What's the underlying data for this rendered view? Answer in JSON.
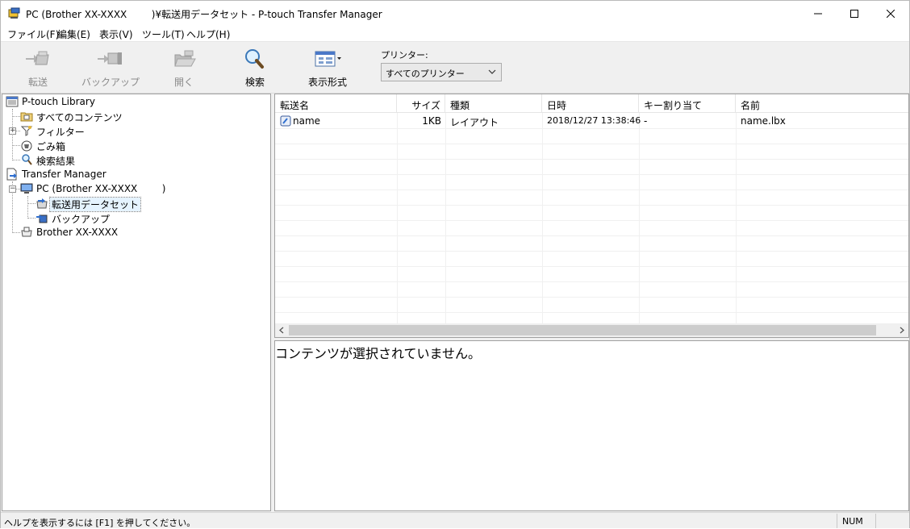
{
  "window": {
    "title": "PC (Brother XX-XXXX        )¥転送用データセット - P-touch Transfer Manager"
  },
  "menu": [
    {
      "label": "ファイル(F)"
    },
    {
      "label": "編集(E)"
    },
    {
      "label": "表示(V)"
    },
    {
      "label": "ツール(T)"
    },
    {
      "label": "ヘルプ(H)"
    }
  ],
  "toolbar": {
    "transfer_label": "転送",
    "backup_label": "バックアップ",
    "open_label": "開く",
    "search_label": "検索",
    "view_label": "表示形式",
    "printer_label": "プリンター:",
    "printer_value": "すべてのプリンター"
  },
  "tree": {
    "library": "P-touch Library",
    "all_contents": "すべてのコンテンツ",
    "filter": "フィルター",
    "trash": "ごみ箱",
    "search_results": "検索結果",
    "transfer_manager": "Transfer Manager",
    "pc": "PC (Brother XX-XXXX        )",
    "transfer_dataset": "転送用データセット",
    "backup": "バックアップ",
    "printer": "Brother XX-XXXX"
  },
  "list": {
    "columns": [
      "転送名",
      "サイズ",
      "種類",
      "日時",
      "キー割り当て",
      "名前"
    ],
    "rows": [
      {
        "transfer_name": "name",
        "size": "1KB",
        "type": "レイアウト",
        "date": "2018/12/27 13:38:46",
        "key": "-",
        "name": "name.lbx"
      }
    ]
  },
  "preview": {
    "message": "コンテンツが選択されていません。"
  },
  "status": {
    "help": "ヘルプを表示するには [F1] を押してください。",
    "num": "NUM"
  },
  "colors": {
    "selected_bg": "#e5f3ff",
    "disabled_text": "#8a8a8a",
    "panel_bg": "#f0f0f0"
  }
}
